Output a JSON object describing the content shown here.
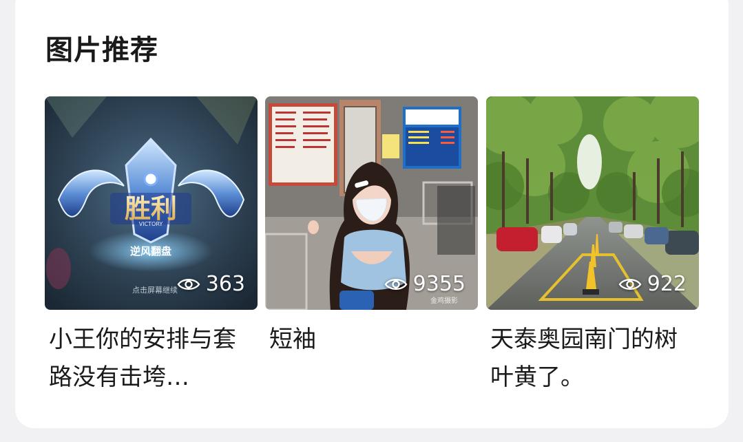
{
  "section": {
    "title": "图片推荐"
  },
  "items": [
    {
      "views": "363",
      "caption": "小王你的安排与套路没有击垮…",
      "badge": "胜利",
      "badge_en": "VICTORY",
      "sub": "逆风翻盘",
      "hint": "点击屏幕继续"
    },
    {
      "views": "9355",
      "caption": "短袖",
      "watermark": "金鸡摄影"
    },
    {
      "views": "922",
      "caption": "天泰奥园南门的树叶黄了。"
    }
  ],
  "colors": {
    "background": "#f1f1f3",
    "card": "#ffffff",
    "text": "#1a1a1a"
  },
  "icons": {
    "views": "eye-icon"
  }
}
